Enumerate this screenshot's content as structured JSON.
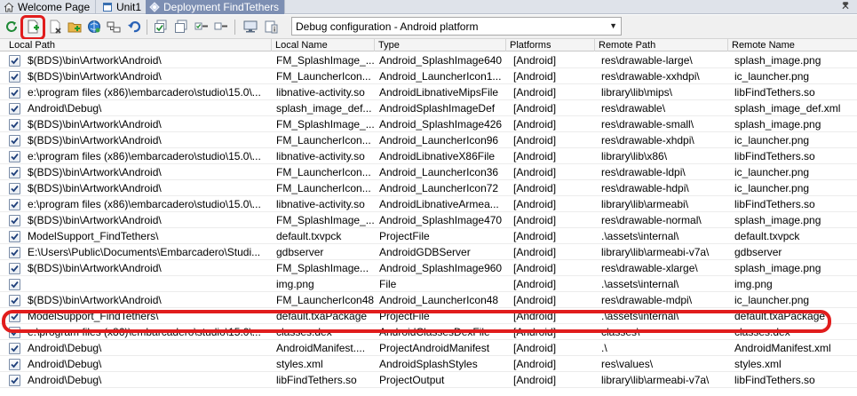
{
  "tabs": [
    {
      "label": "Welcome Page",
      "icon": "home-icon",
      "active": false
    },
    {
      "label": "Unit1",
      "icon": "form-icon",
      "active": false
    },
    {
      "label": "Deployment FindTethers",
      "icon": "deployment-icon",
      "active": true
    }
  ],
  "toolbar": {
    "buttons": [
      "refresh-icon",
      "add-file-icon",
      "remove-file-icon",
      "add-feature-icon",
      "connect-profile-icon",
      "platform-icon",
      "revert-icon",
      "check-all-icon",
      "copy-icon",
      "toggle-icon",
      "toggle-off-icon",
      "deploy-icon",
      "info-icon"
    ],
    "configuration": "Debug configuration - Android platform"
  },
  "columns": [
    "Local Path",
    "Local Name",
    "Type",
    "Platforms",
    "Remote Path",
    "Remote Name"
  ],
  "rows": [
    {
      "checked": true,
      "path": "$(BDS)\\bin\\Artwork\\Android\\",
      "name": "FM_SplashImage_...",
      "type": "Android_SplashImage640",
      "platforms": "[Android]",
      "rpath": "res\\drawable-large\\",
      "rname": "splash_image.png"
    },
    {
      "checked": true,
      "path": "$(BDS)\\bin\\Artwork\\Android\\",
      "name": "FM_LauncherIcon...",
      "type": "Android_LauncherIcon1...",
      "platforms": "[Android]",
      "rpath": "res\\drawable-xxhdpi\\",
      "rname": "ic_launcher.png"
    },
    {
      "checked": true,
      "path": "e:\\program files (x86)\\embarcadero\\studio\\15.0\\...",
      "name": "libnative-activity.so",
      "type": "AndroidLibnativeMipsFile",
      "platforms": "[Android]",
      "rpath": "library\\lib\\mips\\",
      "rname": "libFindTethers.so"
    },
    {
      "checked": true,
      "path": "Android\\Debug\\",
      "name": "splash_image_def...",
      "type": "AndroidSplashImageDef",
      "platforms": "[Android]",
      "rpath": "res\\drawable\\",
      "rname": "splash_image_def.xml"
    },
    {
      "checked": true,
      "path": "$(BDS)\\bin\\Artwork\\Android\\",
      "name": "FM_SplashImage_...",
      "type": "Android_SplashImage426",
      "platforms": "[Android]",
      "rpath": "res\\drawable-small\\",
      "rname": "splash_image.png"
    },
    {
      "checked": true,
      "path": "$(BDS)\\bin\\Artwork\\Android\\",
      "name": "FM_LauncherIcon...",
      "type": "Android_LauncherIcon96",
      "platforms": "[Android]",
      "rpath": "res\\drawable-xhdpi\\",
      "rname": "ic_launcher.png"
    },
    {
      "checked": true,
      "path": "e:\\program files (x86)\\embarcadero\\studio\\15.0\\...",
      "name": "libnative-activity.so",
      "type": "AndroidLibnativeX86File",
      "platforms": "[Android]",
      "rpath": "library\\lib\\x86\\",
      "rname": "libFindTethers.so"
    },
    {
      "checked": true,
      "path": "$(BDS)\\bin\\Artwork\\Android\\",
      "name": "FM_LauncherIcon...",
      "type": "Android_LauncherIcon36",
      "platforms": "[Android]",
      "rpath": "res\\drawable-ldpi\\",
      "rname": "ic_launcher.png"
    },
    {
      "checked": true,
      "path": "$(BDS)\\bin\\Artwork\\Android\\",
      "name": "FM_LauncherIcon...",
      "type": "Android_LauncherIcon72",
      "platforms": "[Android]",
      "rpath": "res\\drawable-hdpi\\",
      "rname": "ic_launcher.png"
    },
    {
      "checked": true,
      "path": "e:\\program files (x86)\\embarcadero\\studio\\15.0\\...",
      "name": "libnative-activity.so",
      "type": "AndroidLibnativeArmea...",
      "platforms": "[Android]",
      "rpath": "library\\lib\\armeabi\\",
      "rname": "libFindTethers.so"
    },
    {
      "checked": true,
      "path": "$(BDS)\\bin\\Artwork\\Android\\",
      "name": "FM_SplashImage_...",
      "type": "Android_SplashImage470",
      "platforms": "[Android]",
      "rpath": "res\\drawable-normal\\",
      "rname": "splash_image.png"
    },
    {
      "checked": true,
      "path": "ModelSupport_FindTethers\\",
      "name": "default.txvpck",
      "type": "ProjectFile",
      "platforms": "[Android]",
      "rpath": ".\\assets\\internal\\",
      "rname": "default.txvpck"
    },
    {
      "checked": true,
      "path": "E:\\Users\\Public\\Documents\\Embarcadero\\Studi...",
      "name": "gdbserver",
      "type": "AndroidGDBServer",
      "platforms": "[Android]",
      "rpath": "library\\lib\\armeabi-v7a\\",
      "rname": "gdbserver"
    },
    {
      "checked": true,
      "path": "$(BDS)\\bin\\Artwork\\Android\\",
      "name": "FM_SplashImage...",
      "type": "Android_SplashImage960",
      "platforms": "[Android]",
      "rpath": "res\\drawable-xlarge\\",
      "rname": "splash_image.png"
    },
    {
      "checked": true,
      "path": "",
      "name": "img.png",
      "type": "File",
      "platforms": "[Android]",
      "rpath": ".\\assets\\internal\\",
      "rname": "img.png"
    },
    {
      "checked": true,
      "path": "$(BDS)\\bin\\Artwork\\Android\\",
      "name": "FM_LauncherIcon48",
      "type": "Android_LauncherIcon48",
      "platforms": "[Android]",
      "rpath": "res\\drawable-mdpi\\",
      "rname": "ic_launcher.png"
    },
    {
      "checked": true,
      "path": "ModelSupport_FindTethers\\",
      "name": "default.txaPackage",
      "type": "ProjectFile",
      "platforms": "[Android]",
      "rpath": ".\\assets\\internal\\",
      "rname": "default.txaPackage"
    },
    {
      "checked": true,
      "path": "e:\\program files (x86)\\embarcadero\\studio\\15.0\\...",
      "name": "classes.dex",
      "type": "AndroidClassesDexFile",
      "platforms": "[Android]",
      "rpath": "classes\\",
      "rname": "classes.dex"
    },
    {
      "checked": true,
      "path": "Android\\Debug\\",
      "name": "AndroidManifest....",
      "type": "ProjectAndroidManifest",
      "platforms": "[Android]",
      "rpath": ".\\",
      "rname": "AndroidManifest.xml"
    },
    {
      "checked": true,
      "path": "Android\\Debug\\",
      "name": "styles.xml",
      "type": "AndroidSplashStyles",
      "platforms": "[Android]",
      "rpath": "res\\values\\",
      "rname": "styles.xml"
    },
    {
      "checked": true,
      "path": "Android\\Debug\\",
      "name": "libFindTethers.so",
      "type": "ProjectOutput",
      "platforms": "[Android]",
      "rpath": "library\\lib\\armeabi-v7a\\",
      "rname": "libFindTethers.so"
    }
  ]
}
